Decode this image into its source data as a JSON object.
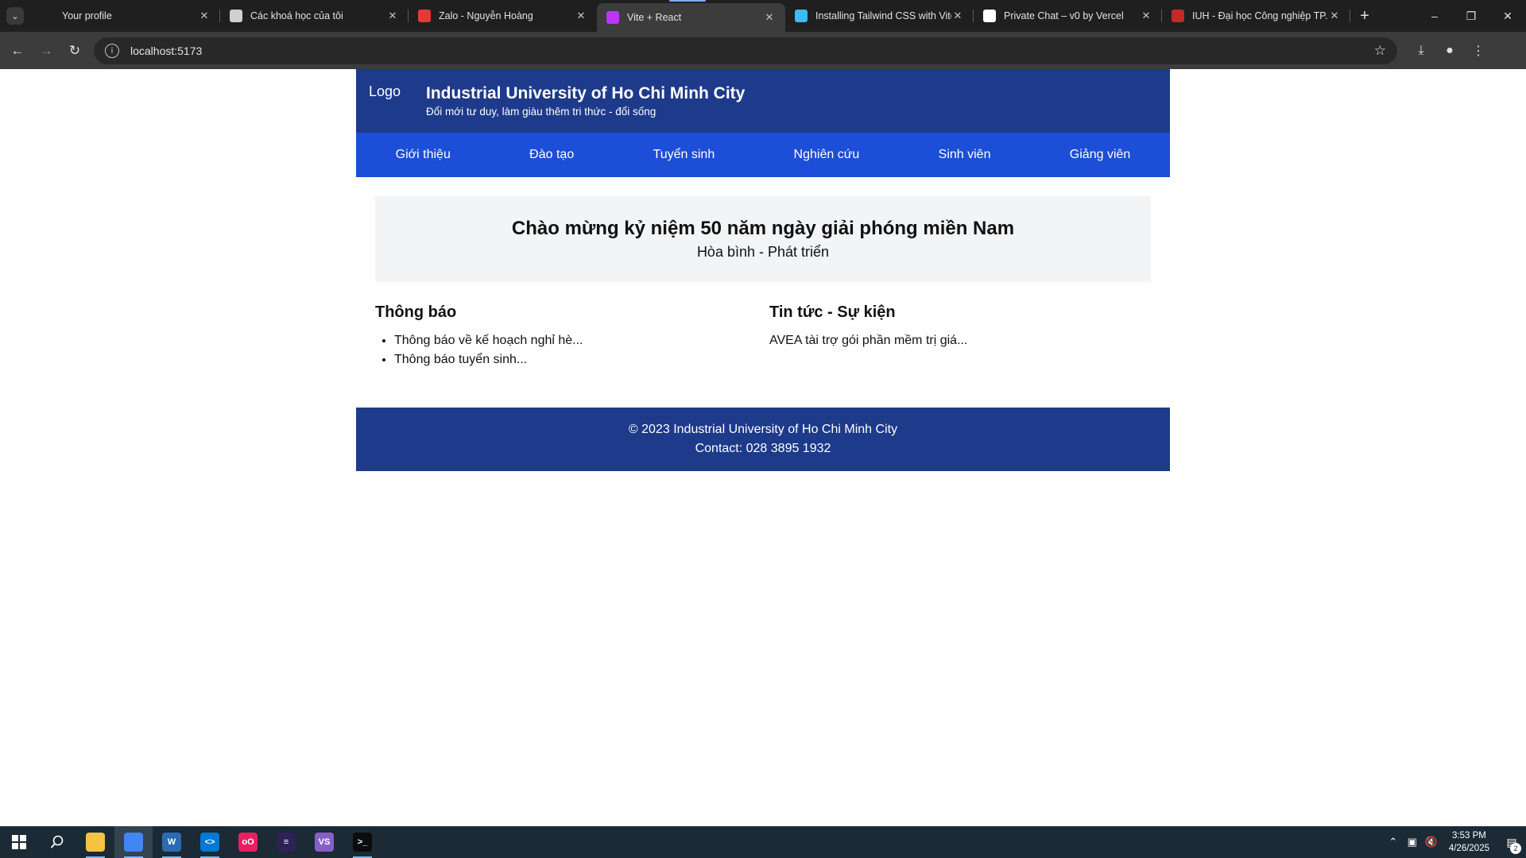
{
  "browser": {
    "tabs": [
      {
        "title": "Your profile",
        "icon": "github-icon",
        "color": "#1f1f1f"
      },
      {
        "title": "Các khoá học của tôi",
        "icon": "book-icon",
        "color": "#d0d0d0"
      },
      {
        "title": "Zalo - Nguyễn Hoàng",
        "icon": "zalo-icon",
        "color": "#e53935"
      },
      {
        "title": "Vite + React",
        "icon": "vite-icon",
        "color": "#bd34fe",
        "active": true
      },
      {
        "title": "Installing Tailwind CSS with Vite",
        "icon": "tailwind-icon",
        "color": "#38bdf8"
      },
      {
        "title": "Private Chat – v0 by Vercel",
        "icon": "v0-icon",
        "color": "#ffffff"
      },
      {
        "title": "IUH - Đại học Công nghiệp TP.HCM",
        "icon": "iuh-icon",
        "color": "#c62828"
      }
    ],
    "url": "localhost:5173"
  },
  "site": {
    "logo_alt": "Logo",
    "title": "Industrial University of Ho Chi Minh City",
    "slogan": "Đổi mới tư duy, làm giàu thêm tri thức - đổi sống",
    "nav": [
      "Giới thiệu",
      "Đào tạo",
      "Tuyển sinh",
      "Nghiên cứu",
      "Sinh viên",
      "Giảng viên"
    ],
    "banner": {
      "title": "Chào mừng kỷ niệm 50 năm ngày giải phóng miền Nam",
      "subtitle": "Hòa bình - Phát triển"
    },
    "notices": {
      "heading": "Thông báo",
      "items": [
        "Thông báo về kế hoạch nghỉ hè...",
        "Thông báo tuyển sinh..."
      ]
    },
    "news": {
      "heading": "Tin tức - Sự kiện",
      "text": "AVEA tài trợ gói phần mềm trị giá..."
    },
    "footer": {
      "copyright": "© 2023 Industrial University of Ho Chi Minh City",
      "contact": "Contact: 028 3895 1932"
    },
    "colors": {
      "header": "#1e3a8a",
      "nav": "#1d4ed8",
      "banner": "#f3f4f6"
    }
  },
  "taskbar": {
    "apps": [
      {
        "name": "file-explorer-icon",
        "color": "#f5c243",
        "label": ""
      },
      {
        "name": "chrome-icon",
        "color": "#4285f4",
        "label": "",
        "active": true
      },
      {
        "name": "word-icon",
        "color": "#2b6cb0",
        "label": "W"
      },
      {
        "name": "vscode-icon",
        "color": "#0078d4",
        "label": "<>"
      },
      {
        "name": "app-icon",
        "color": "#e91e63",
        "label": "oO"
      },
      {
        "name": "eclipse-icon",
        "color": "#2c2255",
        "label": "≡"
      },
      {
        "name": "visual-studio-icon",
        "color": "#865fc5",
        "label": "VS"
      },
      {
        "name": "terminal-icon",
        "color": "#0c0c0c",
        "label": ">_"
      }
    ],
    "time": "3:53 PM",
    "date": "4/26/2025",
    "notification_count": "2"
  }
}
